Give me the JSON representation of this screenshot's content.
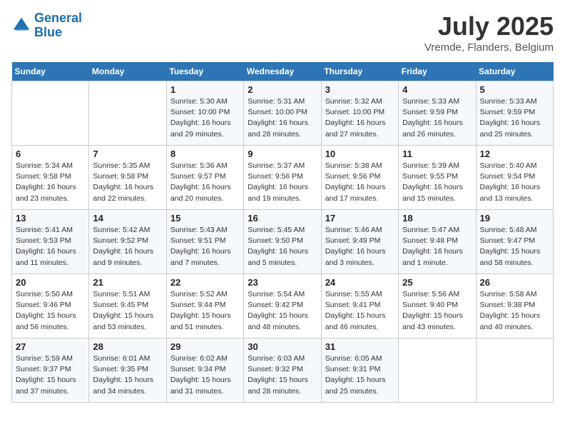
{
  "header": {
    "logo_line1": "General",
    "logo_line2": "Blue",
    "month_title": "July 2025",
    "location": "Vremde, Flanders, Belgium"
  },
  "weekdays": [
    "Sunday",
    "Monday",
    "Tuesday",
    "Wednesday",
    "Thursday",
    "Friday",
    "Saturday"
  ],
  "weeks": [
    [
      {
        "day": "",
        "info": ""
      },
      {
        "day": "",
        "info": ""
      },
      {
        "day": "1",
        "info": "Sunrise: 5:30 AM\nSunset: 10:00 PM\nDaylight: 16 hours\nand 29 minutes."
      },
      {
        "day": "2",
        "info": "Sunrise: 5:31 AM\nSunset: 10:00 PM\nDaylight: 16 hours\nand 28 minutes."
      },
      {
        "day": "3",
        "info": "Sunrise: 5:32 AM\nSunset: 10:00 PM\nDaylight: 16 hours\nand 27 minutes."
      },
      {
        "day": "4",
        "info": "Sunrise: 5:33 AM\nSunset: 9:59 PM\nDaylight: 16 hours\nand 26 minutes."
      },
      {
        "day": "5",
        "info": "Sunrise: 5:33 AM\nSunset: 9:59 PM\nDaylight: 16 hours\nand 25 minutes."
      }
    ],
    [
      {
        "day": "6",
        "info": "Sunrise: 5:34 AM\nSunset: 9:58 PM\nDaylight: 16 hours\nand 23 minutes."
      },
      {
        "day": "7",
        "info": "Sunrise: 5:35 AM\nSunset: 9:58 PM\nDaylight: 16 hours\nand 22 minutes."
      },
      {
        "day": "8",
        "info": "Sunrise: 5:36 AM\nSunset: 9:57 PM\nDaylight: 16 hours\nand 20 minutes."
      },
      {
        "day": "9",
        "info": "Sunrise: 5:37 AM\nSunset: 9:56 PM\nDaylight: 16 hours\nand 19 minutes."
      },
      {
        "day": "10",
        "info": "Sunrise: 5:38 AM\nSunset: 9:56 PM\nDaylight: 16 hours\nand 17 minutes."
      },
      {
        "day": "11",
        "info": "Sunrise: 5:39 AM\nSunset: 9:55 PM\nDaylight: 16 hours\nand 15 minutes."
      },
      {
        "day": "12",
        "info": "Sunrise: 5:40 AM\nSunset: 9:54 PM\nDaylight: 16 hours\nand 13 minutes."
      }
    ],
    [
      {
        "day": "13",
        "info": "Sunrise: 5:41 AM\nSunset: 9:53 PM\nDaylight: 16 hours\nand 11 minutes."
      },
      {
        "day": "14",
        "info": "Sunrise: 5:42 AM\nSunset: 9:52 PM\nDaylight: 16 hours\nand 9 minutes."
      },
      {
        "day": "15",
        "info": "Sunrise: 5:43 AM\nSunset: 9:51 PM\nDaylight: 16 hours\nand 7 minutes."
      },
      {
        "day": "16",
        "info": "Sunrise: 5:45 AM\nSunset: 9:50 PM\nDaylight: 16 hours\nand 5 minutes."
      },
      {
        "day": "17",
        "info": "Sunrise: 5:46 AM\nSunset: 9:49 PM\nDaylight: 16 hours\nand 3 minutes."
      },
      {
        "day": "18",
        "info": "Sunrise: 5:47 AM\nSunset: 9:48 PM\nDaylight: 16 hours\nand 1 minute."
      },
      {
        "day": "19",
        "info": "Sunrise: 5:48 AM\nSunset: 9:47 PM\nDaylight: 15 hours\nand 58 minutes."
      }
    ],
    [
      {
        "day": "20",
        "info": "Sunrise: 5:50 AM\nSunset: 9:46 PM\nDaylight: 15 hours\nand 56 minutes."
      },
      {
        "day": "21",
        "info": "Sunrise: 5:51 AM\nSunset: 9:45 PM\nDaylight: 15 hours\nand 53 minutes."
      },
      {
        "day": "22",
        "info": "Sunrise: 5:52 AM\nSunset: 9:44 PM\nDaylight: 15 hours\nand 51 minutes."
      },
      {
        "day": "23",
        "info": "Sunrise: 5:54 AM\nSunset: 9:42 PM\nDaylight: 15 hours\nand 48 minutes."
      },
      {
        "day": "24",
        "info": "Sunrise: 5:55 AM\nSunset: 9:41 PM\nDaylight: 15 hours\nand 46 minutes."
      },
      {
        "day": "25",
        "info": "Sunrise: 5:56 AM\nSunset: 9:40 PM\nDaylight: 15 hours\nand 43 minutes."
      },
      {
        "day": "26",
        "info": "Sunrise: 5:58 AM\nSunset: 9:38 PM\nDaylight: 15 hours\nand 40 minutes."
      }
    ],
    [
      {
        "day": "27",
        "info": "Sunrise: 5:59 AM\nSunset: 9:37 PM\nDaylight: 15 hours\nand 37 minutes."
      },
      {
        "day": "28",
        "info": "Sunrise: 6:01 AM\nSunset: 9:35 PM\nDaylight: 15 hours\nand 34 minutes."
      },
      {
        "day": "29",
        "info": "Sunrise: 6:02 AM\nSunset: 9:34 PM\nDaylight: 15 hours\nand 31 minutes."
      },
      {
        "day": "30",
        "info": "Sunrise: 6:03 AM\nSunset: 9:32 PM\nDaylight: 15 hours\nand 28 minutes."
      },
      {
        "day": "31",
        "info": "Sunrise: 6:05 AM\nSunset: 9:31 PM\nDaylight: 15 hours\nand 25 minutes."
      },
      {
        "day": "",
        "info": ""
      },
      {
        "day": "",
        "info": ""
      }
    ]
  ]
}
